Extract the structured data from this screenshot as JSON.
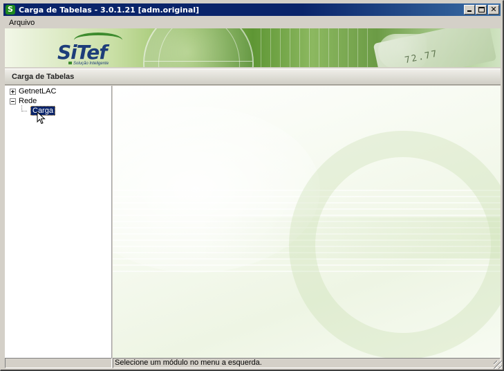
{
  "window": {
    "title": "Carga de Tabelas - 3.0.1.21  [adm.original]",
    "icon_letter": "S",
    "controls": {
      "minimize": "minimize",
      "maximize": "maximize",
      "close": "✕"
    }
  },
  "menubar": {
    "items": [
      {
        "label": "Arquivo"
      }
    ]
  },
  "banner": {
    "logo_text": "SiTef",
    "logo_tagline": "Solução Inteligente",
    "card_number": "72.77"
  },
  "section": {
    "title": "Carga de Tabelas"
  },
  "tree": {
    "nodes": [
      {
        "label": "GetnetLAC",
        "expanded": false
      },
      {
        "label": "Rede",
        "expanded": true,
        "children": [
          {
            "label": "Carga",
            "selected": true
          }
        ]
      }
    ]
  },
  "statusbar": {
    "left": "",
    "message": "Selecione um módulo no menu a esquerda."
  },
  "colors": {
    "titlebar": "#0a246a",
    "selection": "#0a246a",
    "brand_green": "#3d8b2e",
    "brand_blue": "#1d3d7a"
  }
}
